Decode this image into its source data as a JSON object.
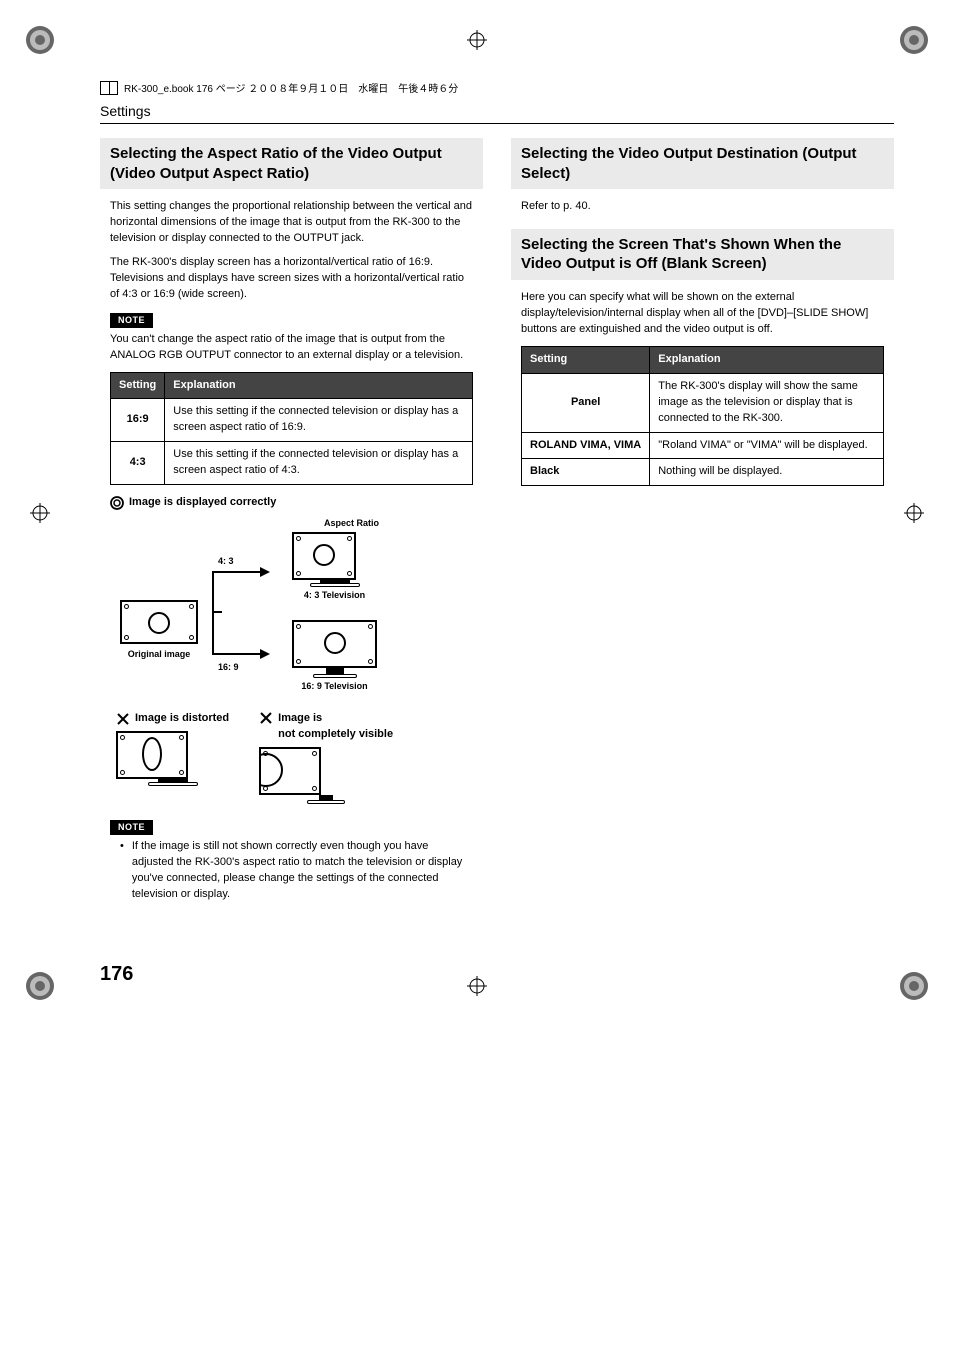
{
  "header_meta": "RK-300_e.book  176 ページ  ２００８年９月１０日　水曜日　午後４時６分",
  "section": "Settings",
  "page_number": "176",
  "left": {
    "h2": "Selecting the Aspect Ratio of the Video Output (Video Output Aspect Ratio)",
    "p1": "This setting changes the proportional relationship between the vertical and horizontal dimensions of the image that is output from the RK-300 to the television or display connected to the OUTPUT jack.",
    "p2": "The RK-300's display screen has a horizontal/vertical ratio of 16:9. Televisions and displays have screen sizes with a horizontal/vertical ratio of 4:3 or 16:9 (wide screen).",
    "note_label": "NOTE",
    "note_text": "You can't change the aspect ratio of the image that is output from the ANALOG RGB OUTPUT connector to an external display or a television.",
    "table_h1": "Setting",
    "table_h2": "Explanation",
    "row1_s": "16:9",
    "row1_e": "Use this setting if the connected television or display has a screen aspect ratio of 16:9.",
    "row2_s": "4:3",
    "row2_e": "Use this setting if the connected television or display has a screen aspect ratio of 4:3.",
    "fig_correct": "Image is displayed correctly",
    "fig_aspect_label": "Aspect Ratio",
    "fig_43": "4: 3",
    "fig_43tv": "4: 3 Television",
    "fig_169": "16: 9",
    "fig_169tv": "16: 9 Television",
    "fig_original": "Original image",
    "fig_distorted": "Image is distorted",
    "fig_notvisible_a": "Image is",
    "fig_notvisible_b": "not completely visible",
    "note2_label": "NOTE",
    "note2_text": "If the image is still not shown correctly even though you have adjusted the RK-300's aspect ratio to match the television or display you've connected, please change the settings of the connected television or display."
  },
  "right": {
    "h2a": "Selecting the Video Output Destination (Output Select)",
    "ref": "Refer to p. 40.",
    "h2b": "Selecting the Screen That's Shown When the Video Output is Off (Blank Screen)",
    "p1": "Here you can specify what will be shown on the external display/television/internal display when all of the [DVD]–[SLIDE SHOW] buttons are extinguished and the video output is off.",
    "table_h1": "Setting",
    "table_h2": "Explanation",
    "r1s": "Panel",
    "r1e": "The RK-300's display will show the same image as the television or display that is connected to the RK-300.",
    "r2s": "ROLAND VIMA, VIMA",
    "r2e": "\"Roland VIMA\" or \"VIMA\" will be displayed.",
    "r3s": "Black",
    "r3e": "Nothing will be displayed."
  }
}
